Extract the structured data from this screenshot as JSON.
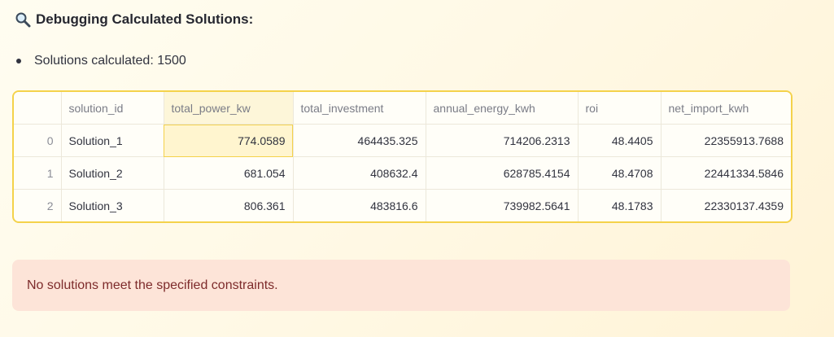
{
  "heading": {
    "icon": "magnifier-icon",
    "text": "Debugging Calculated Solutions:"
  },
  "bullet": {
    "text": "Solutions calculated: 1500"
  },
  "table": {
    "columns": [
      "",
      "solution_id",
      "total_power_kw",
      "total_investment",
      "annual_energy_kwh",
      "roi",
      "net_import_kwh"
    ],
    "rows": [
      [
        "0",
        "Solution_1",
        "774.0589",
        "464435.325",
        "714206.2313",
        "48.4405",
        "22355913.7688"
      ],
      [
        "1",
        "Solution_2",
        "681.054",
        "408632.4",
        "628785.4154",
        "48.4708",
        "22441334.5846"
      ],
      [
        "2",
        "Solution_3",
        "806.361",
        "483816.6",
        "739982.5641",
        "48.1783",
        "22330137.4359"
      ]
    ],
    "selected_cell": {
      "row": 0,
      "column": "total_power_kw"
    }
  },
  "alert": {
    "text": "No solutions meet the specified constraints."
  },
  "colors": {
    "table_border": "#f4d24b",
    "alert_background": "#fde4d8",
    "alert_text": "#7d2b2b"
  }
}
